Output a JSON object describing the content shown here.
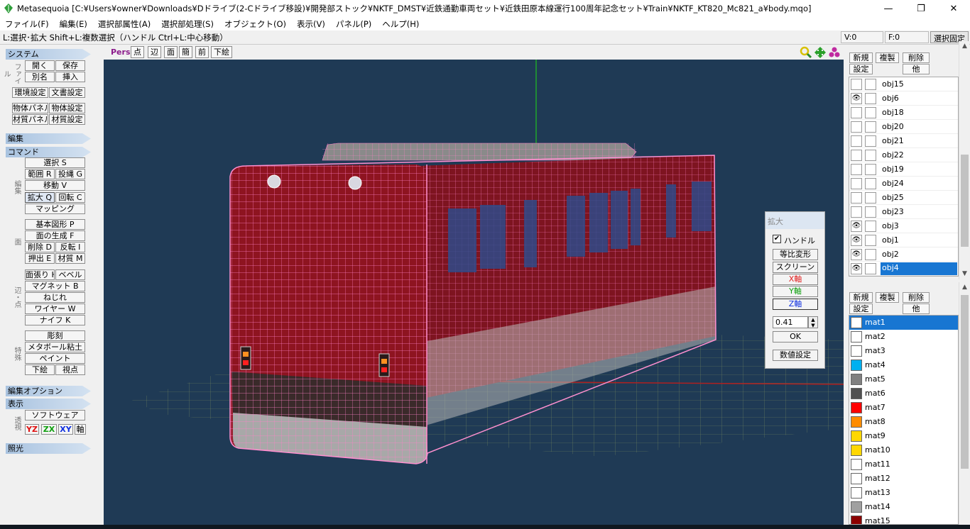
{
  "window": {
    "title": "Metasequoia [C:¥Users¥owner¥Downloads¥Dドライブ(2-Cドライブ移設)¥開発部ストック¥NKTF_DMST¥近鉄通勤車両セット¥近鉄田原本線運行100周年記念セット¥Train¥NKTF_KT820_Mc821_a¥body.mqo]",
    "minimize": "—",
    "maximize": "❐",
    "close": "✕"
  },
  "menu": [
    "ファイル(F)",
    "編集(E)",
    "選択部属性(A)",
    "選択部処理(S)",
    "オブジェクト(O)",
    "表示(V)",
    "パネル(P)",
    "ヘルプ(H)"
  ],
  "status": {
    "hint": "L:選択･拡大  Shift+L:複数選択（ハンドル  Ctrl+L:中心移動）",
    "v": "V:0",
    "f": "F:0",
    "lock_button": "選択固定"
  },
  "left": {
    "system_header": "システム",
    "file_label": "ファイル",
    "open": "開く",
    "save": "保存",
    "save_as": "別名",
    "insert": "挿入",
    "env_settings": "環境設定",
    "doc_settings": "文書設定",
    "object_panel": "物体パネル",
    "object_settings": "物体設定",
    "material_panel": "材質パネル",
    "material_settings": "材質設定",
    "edit_header": "編集",
    "command_header": "コマンド",
    "edit_label": "編集",
    "select": "選択 S",
    "range": "範囲 R",
    "lasso": "投縄 G",
    "move": "移動 V",
    "scale": "拡大 Q",
    "rotate": "回転 C",
    "mapping": "マッピング",
    "face_label": "面",
    "basic_shape": "基本図形 P",
    "face_gen": "面の生成 F",
    "delete": "削除 D",
    "invert": "反転 I",
    "extrude": "押出 E",
    "material": "材質 M",
    "edge_label": "辺・点",
    "stretch": "面張り H",
    "bevel": "ベベル",
    "magnet": "マグネット B",
    "twist": "ねじれ",
    "wire": "ワイヤー W",
    "knife": "ナイフ K",
    "special_label": "特殊",
    "sculpt": "彫刻",
    "metaball": "メタボール粘土",
    "paint": "ペイント",
    "underlay": "下絵",
    "viewpoint": "視点",
    "edit_option_header": "編集オプション",
    "display_header": "表示",
    "perspective_label": "透視",
    "software": "ソフトウェア",
    "yz": "YZ",
    "zx": "ZX",
    "xy": "XY",
    "axis": "軸",
    "light_header": "照光"
  },
  "viewport_toolbar": {
    "pers": "Pers",
    "point": "点",
    "edge": "辺",
    "face": "面",
    "simple": "簡",
    "front": "前",
    "underlay": "下絵"
  },
  "scale_dialog": {
    "title": "拡大",
    "handle_label": "ハンドル",
    "handle_checked": "✔",
    "uniform": "等比変形",
    "screen": "スクリーン",
    "x_axis": "X軸",
    "y_axis": "Y軸",
    "z_axis": "Z軸",
    "value": "0.41",
    "ok": "OK",
    "numeric": "数値設定"
  },
  "object_panel": {
    "new": "新規",
    "duplicate": "複製",
    "delete": "削除",
    "settings": "設定",
    "other": "他",
    "items": [
      {
        "name": "obj15",
        "visible": false
      },
      {
        "name": "obj6",
        "visible": true
      },
      {
        "name": "obj18",
        "visible": false
      },
      {
        "name": "obj20",
        "visible": false
      },
      {
        "name": "obj21",
        "visible": false
      },
      {
        "name": "obj22",
        "visible": false
      },
      {
        "name": "obj19",
        "visible": false
      },
      {
        "name": "obj24",
        "visible": false
      },
      {
        "name": "obj25",
        "visible": false
      },
      {
        "name": "obj23",
        "visible": false
      },
      {
        "name": "obj3",
        "visible": true
      },
      {
        "name": "obj1",
        "visible": true
      },
      {
        "name": "obj2",
        "visible": true
      },
      {
        "name": "obj4",
        "visible": true,
        "selected": true
      }
    ]
  },
  "material_panel": {
    "new": "新規",
    "duplicate": "複製",
    "delete": "削除",
    "settings": "設定",
    "other": "他",
    "items": [
      {
        "name": "mat1",
        "color": "#ffffff",
        "selected": true
      },
      {
        "name": "mat2",
        "color": "#ffffff"
      },
      {
        "name": "mat3",
        "color": "#ffffff"
      },
      {
        "name": "mat4",
        "color": "#00b0f0"
      },
      {
        "name": "mat5",
        "color": "#808080"
      },
      {
        "name": "mat6",
        "color": "#505050"
      },
      {
        "name": "mat7",
        "color": "#ff0000"
      },
      {
        "name": "mat8",
        "color": "#ff8c00"
      },
      {
        "name": "mat9",
        "color": "#ffd700"
      },
      {
        "name": "mat10",
        "color": "#ffd700"
      },
      {
        "name": "mat11",
        "color": "#ffffff"
      },
      {
        "name": "mat12",
        "color": "#ffffff"
      },
      {
        "name": "mat13",
        "color": "#ffffff"
      },
      {
        "name": "mat14",
        "color": "#a0a0a0"
      },
      {
        "name": "mat15",
        "color": "#8b0000"
      }
    ]
  },
  "colors": {
    "viewport_bg": "#1f3a55",
    "wire": "#ff80c8",
    "body_red": "#8e1420",
    "selection": "#1876d2"
  }
}
